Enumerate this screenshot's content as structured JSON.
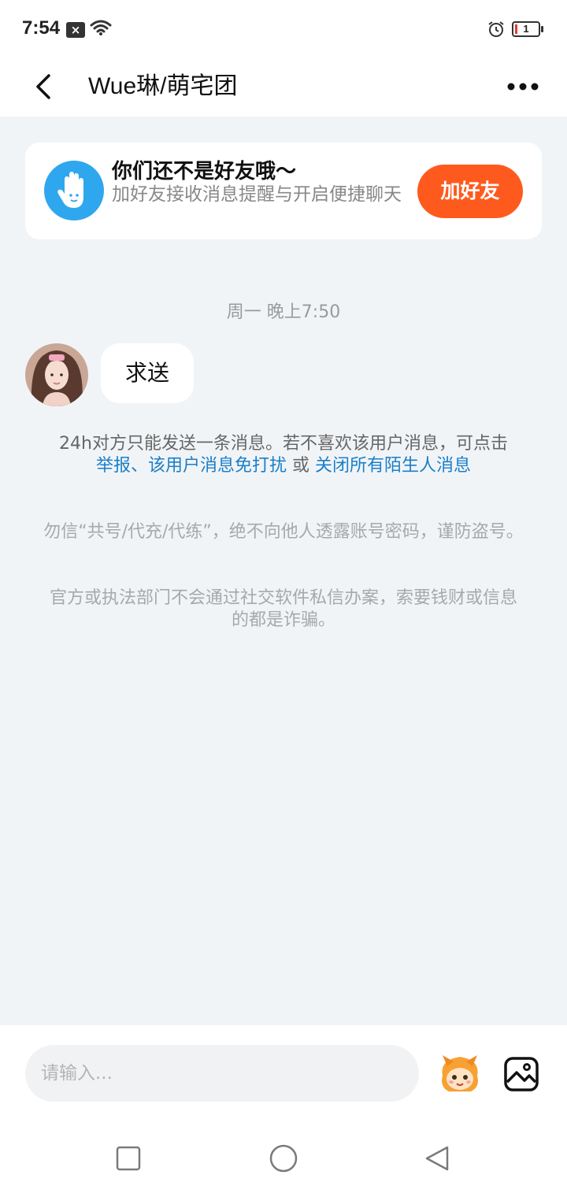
{
  "status_bar": {
    "time": "7:54",
    "notification_icon": "close-box-icon",
    "battery_level": "1"
  },
  "nav": {
    "title": "Wue琳/萌宅团",
    "back_icon": "back-chevron-icon",
    "more_icon": "more-dots-icon"
  },
  "friend_card": {
    "title": "你们还不是好友哦～",
    "subtitle": "加好友接收消息提醒与开启便捷聊天",
    "button_label": "加好友",
    "icon": "hand-wave-icon",
    "button_color": "#ff5a1e"
  },
  "chat": {
    "timestamp": "周一 晚上7:50",
    "messages": [
      {
        "sender": "other",
        "text": "求送"
      }
    ]
  },
  "notice": {
    "line1": "24h对方只能发送一条消息。若不喜欢该用户消息，可点击",
    "link_report": "举报",
    "sep": "、",
    "link_mute": "该用户消息免打扰",
    "or_text": " 或 ",
    "link_close_all": "关闭所有陌生人消息",
    "link_color": "#1a7fc9"
  },
  "warnings": [
    "勿信“共号/代充/代练”，绝不向他人透露账号密码，谨防盗号。",
    "官方或执法部门不会通过社交软件私信办案，索要钱财或信息的都是诈骗。"
  ],
  "input": {
    "placeholder": "请输入...",
    "emoji_icon": "mascot-emoji-icon",
    "image_icon": "image-icon"
  },
  "system_nav": {
    "recent_icon": "square-icon",
    "home_icon": "circle-icon",
    "back_icon": "triangle-back-icon"
  }
}
